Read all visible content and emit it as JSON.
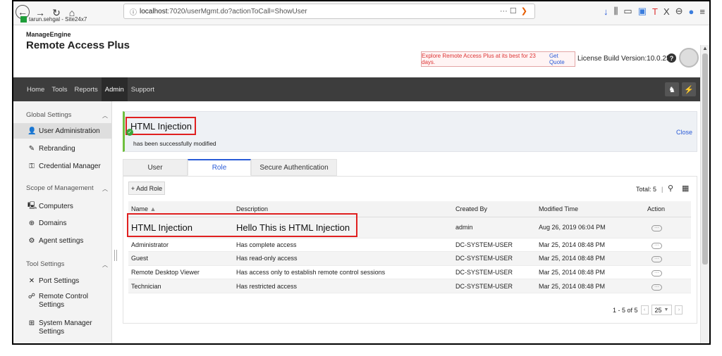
{
  "browser": {
    "url_host": "localhost",
    "url_path": ":7020/userMgmt.do?actionToCall=ShowUser",
    "url_icons": "··· ☐",
    "bookmark": "tarun.sehgal - Site24x7"
  },
  "header": {
    "brand_small": "ManageEngine",
    "brand_big": "Remote Access Plus",
    "promo_text": "Explore Remote Access Plus at its best for 23 days.",
    "promo_link": "Get Quote",
    "license": "License",
    "build": "Build Version:10.0.259",
    "help": "?"
  },
  "topnav": {
    "items": [
      "Home",
      "Tools",
      "Reports",
      "Admin",
      "Support"
    ],
    "active": "Admin"
  },
  "sidebar": {
    "group1": "Global Settings",
    "items1": [
      "User Administration",
      "Rebranding",
      "Credential Manager"
    ],
    "group2": "Scope of Management",
    "items2": [
      "Computers",
      "Domains",
      "Agent settings"
    ],
    "group3": "Tool Settings",
    "items3": [
      "Port Settings",
      "Remote Control Settings",
      "System Manager Settings"
    ]
  },
  "notice": {
    "title": "HTML Injection",
    "subtitle": "has been successfully modified",
    "close": "Close"
  },
  "tabs": [
    "User",
    "Role",
    "Secure Authentication"
  ],
  "toolbar": {
    "add_role": "+ Add Role",
    "total": "Total: 5"
  },
  "table": {
    "headers": [
      "Name",
      "Description",
      "Created By",
      "Modified Time",
      "Action"
    ],
    "rows": [
      {
        "name": "HTML Injection",
        "description": "Hello This is HTML Injection",
        "created_by": "admin",
        "modified": "Aug 26, 2019 06:04 PM"
      },
      {
        "name": "Administrator",
        "description": "Has complete access",
        "created_by": "DC-SYSTEM-USER",
        "modified": "Mar 25, 2014 08:48 PM"
      },
      {
        "name": "Guest",
        "description": "Has read-only access",
        "created_by": "DC-SYSTEM-USER",
        "modified": "Mar 25, 2014 08:48 PM"
      },
      {
        "name": "Remote Desktop Viewer",
        "description": "Has access only to establish remote control sessions",
        "created_by": "DC-SYSTEM-USER",
        "modified": "Mar 25, 2014 08:48 PM"
      },
      {
        "name": "Technician",
        "description": "Has restricted access",
        "created_by": "DC-SYSTEM-USER",
        "modified": "Mar 25, 2014 08:48 PM"
      }
    ]
  },
  "pager": {
    "range": "1 - 5 of 5",
    "page_size": "25"
  }
}
